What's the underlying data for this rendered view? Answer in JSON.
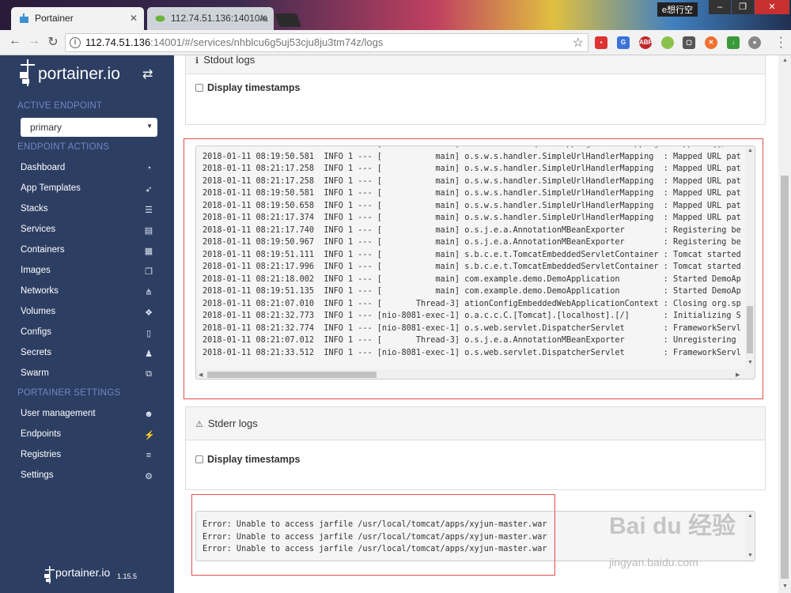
{
  "browser": {
    "tabs": [
      {
        "title": "Portainer",
        "active": true
      },
      {
        "title": "112.74.51.136:14010/a",
        "active": false
      }
    ],
    "window_label": "e想行空",
    "url_host": "112.74.51.136",
    "url_rest": ":14001/#/services/nhblcu6g5uj53cju8ju3tm74z/logs",
    "window_buttons": [
      "–",
      "❐",
      "✕"
    ]
  },
  "sidebar": {
    "logo": "portainer.io",
    "section_active_endpoint": "ACTIVE ENDPOINT",
    "endpoint_selected": "primary",
    "section_endpoint_actions": "ENDPOINT ACTIONS",
    "endpoint_items": [
      {
        "label": "Dashboard",
        "icon": "tachometer-icon"
      },
      {
        "label": "App Templates",
        "icon": "rocket-icon"
      },
      {
        "label": "Stacks",
        "icon": "list-icon"
      },
      {
        "label": "Services",
        "icon": "services-icon"
      },
      {
        "label": "Containers",
        "icon": "containers-icon"
      },
      {
        "label": "Images",
        "icon": "clone-icon"
      },
      {
        "label": "Networks",
        "icon": "sitemap-icon"
      },
      {
        "label": "Volumes",
        "icon": "cubes-icon"
      },
      {
        "label": "Configs",
        "icon": "file-code-icon"
      },
      {
        "label": "Secrets",
        "icon": "user-secret-icon"
      },
      {
        "label": "Swarm",
        "icon": "object-group-icon"
      }
    ],
    "section_settings": "PORTAINER SETTINGS",
    "settings_items": [
      {
        "label": "User management",
        "icon": "users-icon"
      },
      {
        "label": "Endpoints",
        "icon": "plug-icon"
      },
      {
        "label": "Registries",
        "icon": "database-icon"
      },
      {
        "label": "Settings",
        "icon": "cogs-icon"
      }
    ],
    "footer_logo": "portainer.io",
    "version": "1.15.5"
  },
  "stdout": {
    "heading": "Stdout logs",
    "display_timestamps": "Display timestamps",
    "lines": [
      "2018-01-11 08:19:50.581  INFO 1 --- [           main] o.s.w.s.handler.SimpleUrlHandlerMapping  : Mapped URL pat",
      "2018-01-11 08:21:17.258  INFO 1 --- [           main] o.s.w.s.handler.SimpleUrlHandlerMapping  : Mapped URL pat",
      "2018-01-11 08:21:17.258  INFO 1 --- [           main] o.s.w.s.handler.SimpleUrlHandlerMapping  : Mapped URL pat",
      "2018-01-11 08:19:50.581  INFO 1 --- [           main] o.s.w.s.handler.SimpleUrlHandlerMapping  : Mapped URL pat",
      "2018-01-11 08:19:50.658  INFO 1 --- [           main] o.s.w.s.handler.SimpleUrlHandlerMapping  : Mapped URL pat",
      "2018-01-11 08:21:17.374  INFO 1 --- [           main] o.s.w.s.handler.SimpleUrlHandlerMapping  : Mapped URL pat",
      "2018-01-11 08:21:17.740  INFO 1 --- [           main] o.s.j.e.a.AnnotationMBeanExporter        : Registering be",
      "2018-01-11 08:19:50.967  INFO 1 --- [           main] o.s.j.e.a.AnnotationMBeanExporter        : Registering be",
      "2018-01-11 08:19:51.111  INFO 1 --- [           main] s.b.c.e.t.TomcatEmbeddedServletContainer : Tomcat started",
      "2018-01-11 08:21:17.996  INFO 1 --- [           main] s.b.c.e.t.TomcatEmbeddedServletContainer : Tomcat started",
      "2018-01-11 08:21:18.002  INFO 1 --- [           main] com.example.demo.DemoApplication         : Started DemoAp",
      "2018-01-11 08:19:51.135  INFO 1 --- [           main] com.example.demo.DemoApplication         : Started DemoAp",
      "2018-01-11 08:21:07.010  INFO 1 --- [       Thread-3] ationConfigEmbeddedWebApplicationContext : Closing org.sp",
      "2018-01-11 08:21:32.773  INFO 1 --- [nio-8081-exec-1] o.a.c.c.C.[Tomcat].[localhost].[/]       : Initializing S",
      "2018-01-11 08:21:32.774  INFO 1 --- [nio-8081-exec-1] o.s.web.servlet.DispatcherServlet        : FrameworkServl",
      "2018-01-11 08:21:07.012  INFO 1 --- [       Thread-3] o.s.j.e.a.AnnotationMBeanExporter        : Unregistering ",
      "2018-01-11 08:21:33.512  INFO 1 --- [nio-8081-exec-1] o.s.web.servlet.DispatcherServlet        : FrameworkServl"
    ]
  },
  "stderr": {
    "heading": "Stderr logs",
    "display_timestamps": "Display timestamps",
    "lines": [
      "Error: Unable to access jarfile /usr/local/tomcat/apps/xyjun-master.war",
      "Error: Unable to access jarfile /usr/local/tomcat/apps/xyjun-master.war",
      "Error: Unable to access jarfile /usr/local/tomcat/apps/xyjun-master.war"
    ]
  },
  "watermark": {
    "brand": "Bai du 经验",
    "url": "jingyan.baidu.com"
  },
  "colors": {
    "sidebar": "#2d3e63",
    "section": "#6f87c4",
    "annotation": "#e05050"
  }
}
